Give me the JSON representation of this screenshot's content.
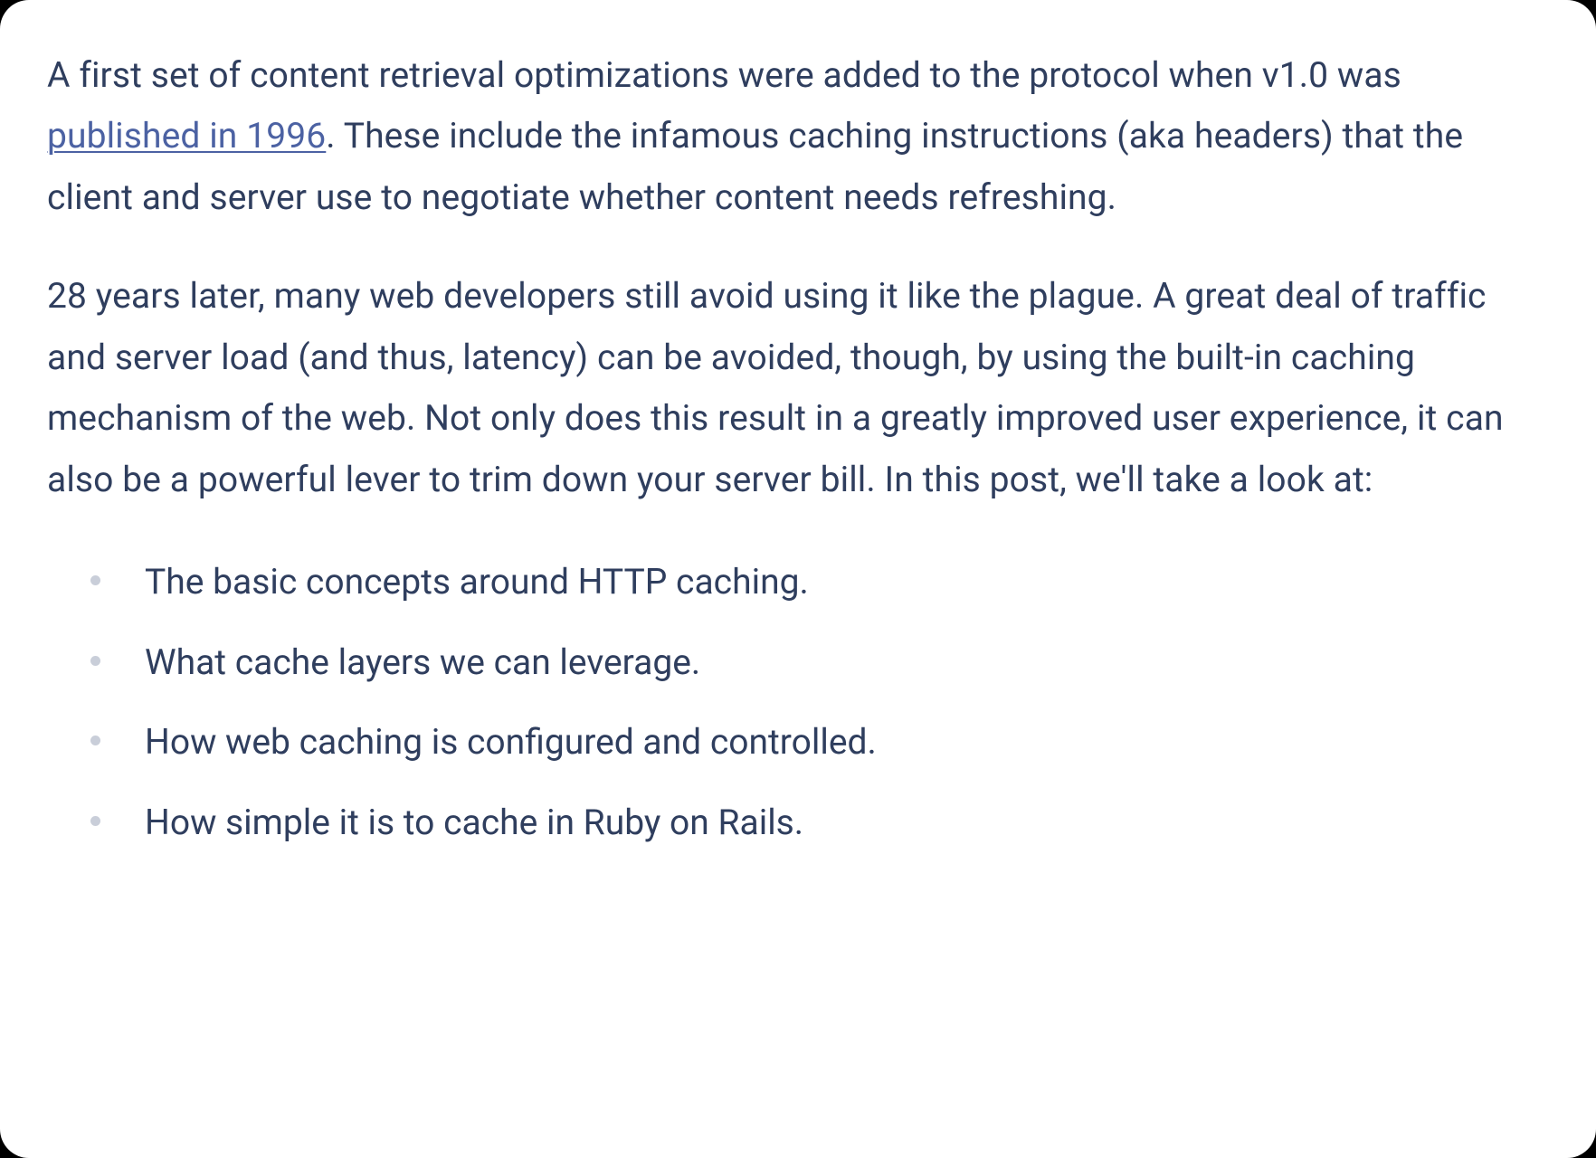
{
  "paragraph1": {
    "part1": "A first set of content retrieval optimizations were added to the protocol when v1.0 was ",
    "link": "published in 1996",
    "part2": ". These include the infamous caching instructions (aka headers) that the client and server use to negotiate whether content needs refreshing."
  },
  "paragraph2": "28 years later, many web developers still avoid using it like the plague. A great deal of traffic and server load (and thus, latency) can be avoided, though, by using the built-in caching mechanism of the web. Not only does this result in a greatly improved user experience, it can also be a powerful lever to trim down your server bill. In this post, we'll take a look at:",
  "bullets": {
    "item0": "The basic concepts around HTTP caching.",
    "item1": "What cache layers we can leverage.",
    "item2": "How web caching is configured and controlled.",
    "item3": "How simple it is to cache in Ruby on Rails."
  }
}
